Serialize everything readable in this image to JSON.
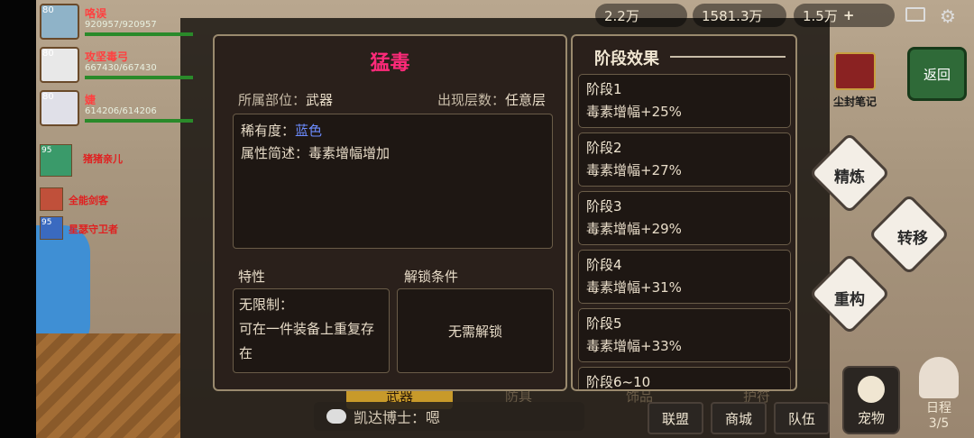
{
  "hud": {
    "res1": "2.2万",
    "res2": "1581.3万",
    "res3": "1.5万"
  },
  "party": [
    {
      "level": "80",
      "name": "咯误",
      "hp": "920957/920957"
    },
    {
      "level": "80",
      "name": "攻坚毒弓",
      "hp": "667430/667430"
    },
    {
      "level": "80",
      "name": "婕",
      "hp": "614206/614206"
    }
  ],
  "pets": [
    {
      "level": "95",
      "name": "猪猪亲儿"
    },
    {
      "level": "",
      "name": "全能剑客"
    },
    {
      "level": "95",
      "name": "星瑟守卫者"
    }
  ],
  "side": {
    "return_label": "返回",
    "dust_label": "尘封笔记",
    "refine_label": "精炼",
    "transfer_label": "转移",
    "rebuild_label": "重构"
  },
  "bottom": {
    "tab_weapon": "武器",
    "tab_armor": "防具",
    "tab_accessory": "饰品",
    "tab_misc": "护符",
    "chat_text": "凯达博士：嗯",
    "alliance": "联盟",
    "shop": "商城",
    "team": "队伍",
    "pet": "宠物",
    "schedule": "日程",
    "schedule_count": "3/5"
  },
  "item": {
    "title": "猛毒",
    "slot_label": "所属部位：",
    "slot_value": "武器",
    "floor_label": "出现层数：",
    "floor_value": "任意层",
    "rarity_label": "稀有度：",
    "rarity_value": "蓝色",
    "desc_label": "属性简述：",
    "desc_value": "毒素增幅增加",
    "feature_label": "特性",
    "feature_line1": "无限制：",
    "feature_line2": "可在一件装备上重复存在",
    "unlock_label": "解锁条件",
    "unlock_value": "无需解锁",
    "rarity_color": "#6c8cff",
    "title_color": "#ff2a7a"
  },
  "stages": {
    "header": "阶段效果",
    "items": [
      {
        "name": "阶段1",
        "effect": "毒素增幅+25%"
      },
      {
        "name": "阶段2",
        "effect": "毒素增幅+27%"
      },
      {
        "name": "阶段3",
        "effect": "毒素增幅+29%"
      },
      {
        "name": "阶段4",
        "effect": "毒素增幅+31%"
      },
      {
        "name": "阶段5",
        "effect": "毒素增幅+33%"
      },
      {
        "name": "阶段6~10",
        "effect": ""
      }
    ]
  }
}
